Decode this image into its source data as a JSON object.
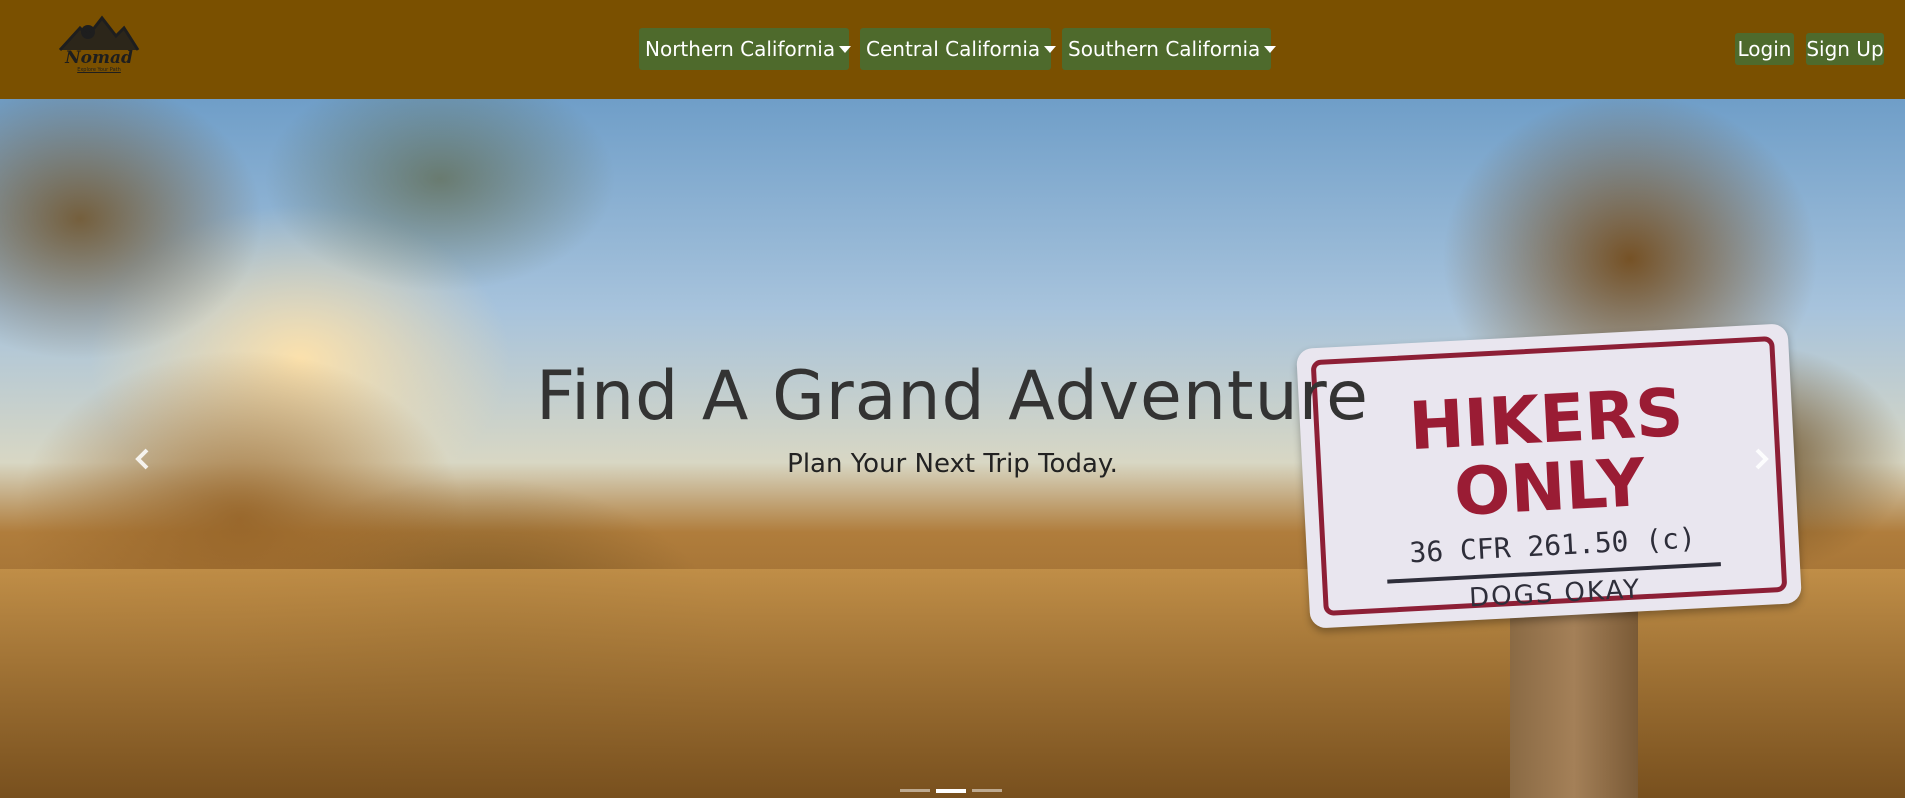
{
  "brand": {
    "name": "Nomad",
    "tagline": "Explore Your Path",
    "icon": "mountain-logo-icon"
  },
  "nav": {
    "menus": [
      {
        "label": "Northern California",
        "icon": "caret-down-icon"
      },
      {
        "label": "Central California",
        "icon": "caret-down-icon"
      },
      {
        "label": "Southern California",
        "icon": "caret-down-icon"
      }
    ],
    "login_label": "Login",
    "signup_label": "Sign Up"
  },
  "hero": {
    "title": "Find A Grand Adventure",
    "subtitle": "Plan Your Next Trip Today.",
    "sign": {
      "line1": "HIKERS",
      "line2": "ONLY",
      "line3": "36 CFR 261.50 (c)",
      "line4": "DOGS OKAY"
    },
    "prev_icon": "chevron-left-icon",
    "next_icon": "chevron-right-icon",
    "slides_count": 3,
    "active_slide": 2
  },
  "colors": {
    "navbar": "#7a5000",
    "button": "#4e6a2c",
    "button_text": "#ffffff",
    "hero_title": "#333333"
  }
}
